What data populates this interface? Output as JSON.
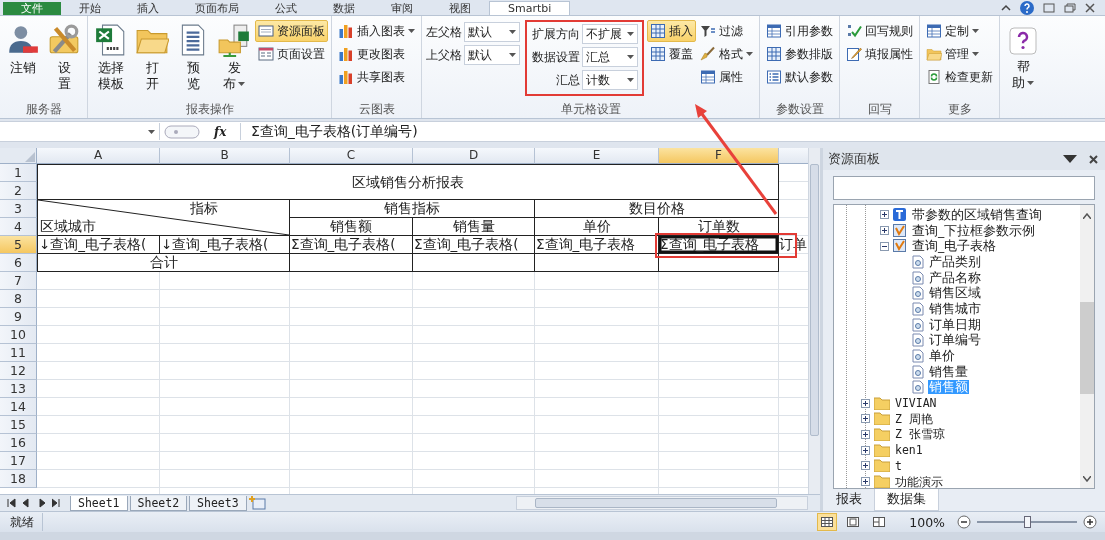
{
  "tabs": [
    {
      "label": "文件",
      "kind": "file",
      "selected": false
    },
    {
      "label": "开始",
      "kind": "tab",
      "selected": false
    },
    {
      "label": "插入",
      "kind": "tab",
      "selected": false
    },
    {
      "label": "页面布局",
      "kind": "tab",
      "selected": false
    },
    {
      "label": "公式",
      "kind": "tab",
      "selected": false
    },
    {
      "label": "数据",
      "kind": "tab",
      "selected": false
    },
    {
      "label": "审阅",
      "kind": "tab",
      "selected": false
    },
    {
      "label": "视图",
      "kind": "tab",
      "selected": false
    },
    {
      "label": "Smartbi",
      "kind": "tab",
      "selected": true
    }
  ],
  "ribbon": {
    "groups": [
      {
        "kind": "big",
        "title": "服务器",
        "buttons": [
          {
            "label": [
              "注销"
            ]
          },
          {
            "label": [
              "设",
              "置"
            ]
          }
        ]
      },
      {
        "kind": "big",
        "title": "报表操作",
        "buttons": [
          {
            "label": [
              "选择",
              "模板"
            ]
          },
          {
            "label": [
              "打",
              "开"
            ]
          },
          {
            "label": [
              "预",
              "览"
            ]
          },
          {
            "label": [
              "发",
              "布"
            ],
            "dropdown": true
          }
        ],
        "columns": [
          [
            {
              "label": "资源面板",
              "on": true
            },
            {
              "label": "页面设置",
              "on": false
            }
          ]
        ]
      },
      {
        "kind": "small",
        "title": "云图表",
        "columns": [
          [
            {
              "label": "插入图表",
              "dropdown": true,
              "on": false
            },
            {
              "label": "更改图表",
              "on": false
            },
            {
              "label": "共享图表",
              "on": false
            }
          ]
        ]
      },
      {
        "kind": "cell",
        "title": "单元格设置",
        "parents": [
          {
            "label": "左父格",
            "value": "默认"
          },
          {
            "label": "上父格",
            "value": "默认"
          }
        ],
        "settings": [
          {
            "label": "扩展方向",
            "value": "不扩展"
          },
          {
            "label": "数据设置",
            "value": "汇总"
          },
          {
            "label": "汇总",
            "value": "计数"
          }
        ],
        "columns": [
          [
            {
              "label": "插入",
              "on": true
            },
            {
              "label": "覆盖",
              "on": false
            }
          ],
          [
            {
              "label": "过滤",
              "on": false
            },
            {
              "label": "格式",
              "dropdown": true,
              "on": false
            },
            {
              "label": "属性",
              "on": false
            }
          ]
        ]
      },
      {
        "kind": "small",
        "title": "参数设置",
        "columns": [
          [
            {
              "label": "引用参数",
              "on": false
            },
            {
              "label": "参数排版",
              "on": false
            },
            {
              "label": "默认参数",
              "on": false
            }
          ]
        ]
      },
      {
        "kind": "small",
        "title": "回写",
        "columns": [
          [
            {
              "label": "回写规则",
              "on": false
            },
            {
              "label": "填报属性",
              "on": false
            }
          ]
        ]
      },
      {
        "kind": "small",
        "title": "更多",
        "columns": [
          [
            {
              "label": "定制",
              "dropdown": true,
              "on": false
            },
            {
              "label": "管理",
              "dropdown": true,
              "on": false
            },
            {
              "label": "检查更新",
              "on": false
            }
          ]
        ]
      },
      {
        "kind": "help",
        "label": [
          "帮",
          "助"
        ],
        "dropdown": true
      }
    ]
  },
  "formula_bar": {
    "function_button": "fx",
    "formula": "Σ查询_电子表格(订单编号)"
  },
  "sheet": {
    "columns": [
      {
        "label": "A",
        "selected": false
      },
      {
        "label": "B",
        "selected": false
      },
      {
        "label": "C",
        "selected": false
      },
      {
        "label": "D",
        "selected": false
      },
      {
        "label": "E",
        "selected": false
      },
      {
        "label": "F",
        "selected": true
      }
    ],
    "rows": [
      {
        "label": "1",
        "selected": false
      },
      {
        "label": "2",
        "selected": false
      },
      {
        "label": "3",
        "selected": false
      },
      {
        "label": "4",
        "selected": false
      },
      {
        "label": "5",
        "selected": true
      },
      {
        "label": "6",
        "selected": false
      },
      {
        "label": "7",
        "selected": false
      },
      {
        "label": "8",
        "selected": false
      },
      {
        "label": "9",
        "selected": false
      },
      {
        "label": "10",
        "selected": false
      },
      {
        "label": "11",
        "selected": false
      },
      {
        "label": "12",
        "selected": false
      },
      {
        "label": "13",
        "selected": false
      },
      {
        "label": "14",
        "selected": false
      },
      {
        "label": "15",
        "selected": false
      },
      {
        "label": "16",
        "selected": false
      },
      {
        "label": "17",
        "selected": false
      },
      {
        "label": "18",
        "selected": false
      }
    ],
    "report": {
      "title": "区域销售分析报表",
      "corner_top": "指标",
      "corner_bottom": "区域城市",
      "groups": [
        "销售指标",
        "数目价格"
      ],
      "headers": [
        "销售额",
        "销售量",
        "单价",
        "订单数"
      ],
      "detail_row": [
        {
          "text": "↓查询_电子表格(",
          "selected": false
        },
        {
          "text": "↓查询_电子表格(",
          "selected": false
        },
        {
          "text": "Σ查询_电子表格(",
          "selected": false
        },
        {
          "text": "Σ查询_电子表格(",
          "selected": false
        },
        {
          "text": "Σ查询_电子表格",
          "selected": false
        },
        {
          "text": "Σ查询_电子表格",
          "selected": true
        }
      ],
      "overflow_text": "订单",
      "total_label": "合计"
    },
    "tabs": [
      {
        "label": "Sheet1",
        "selected": true
      },
      {
        "label": "Sheet2",
        "selected": false
      },
      {
        "label": "Sheet3",
        "selected": false
      }
    ]
  },
  "panel": {
    "title": "资源面板",
    "tree": {
      "branch": [
        {
          "kind": "table",
          "label": "带参数的区域销售查询",
          "expanded": false
        },
        {
          "kind": "query",
          "label": "查询_下拉框参数示例",
          "expanded": false
        },
        {
          "kind": "query",
          "label": "查询_电子表格",
          "expanded": true,
          "children": [
            {
              "label": "产品类别",
              "selected": false
            },
            {
              "label": "产品名称",
              "selected": false
            },
            {
              "label": "销售区域",
              "selected": false
            },
            {
              "label": "销售城市",
              "selected": false
            },
            {
              "label": "订单日期",
              "selected": false
            },
            {
              "label": "订单编号",
              "selected": false
            },
            {
              "label": "单价",
              "selected": false
            },
            {
              "label": "销售量",
              "selected": false
            },
            {
              "label": "销售额",
              "selected": true
            }
          ]
        }
      ],
      "folders": [
        {
          "label": "VIVIAN",
          "expanded": false
        },
        {
          "label": "Z 周艳",
          "expanded": false
        },
        {
          "label": "Z 张雪琼",
          "expanded": false
        },
        {
          "label": "ken1",
          "expanded": false
        },
        {
          "label": "t",
          "expanded": false
        },
        {
          "label": "功能演示",
          "expanded": false
        }
      ]
    },
    "tabs": [
      {
        "label": "报表",
        "selected": false
      },
      {
        "label": "数据集",
        "selected": true
      }
    ]
  },
  "status_bar": {
    "text": "就绪",
    "views": [
      {
        "kind": "normal",
        "selected": true
      },
      {
        "kind": "page-layout",
        "selected": false
      },
      {
        "kind": "page-break",
        "selected": false
      }
    ],
    "zoom": "100%",
    "zoom_slider": {
      "level": 0.5
    }
  }
}
